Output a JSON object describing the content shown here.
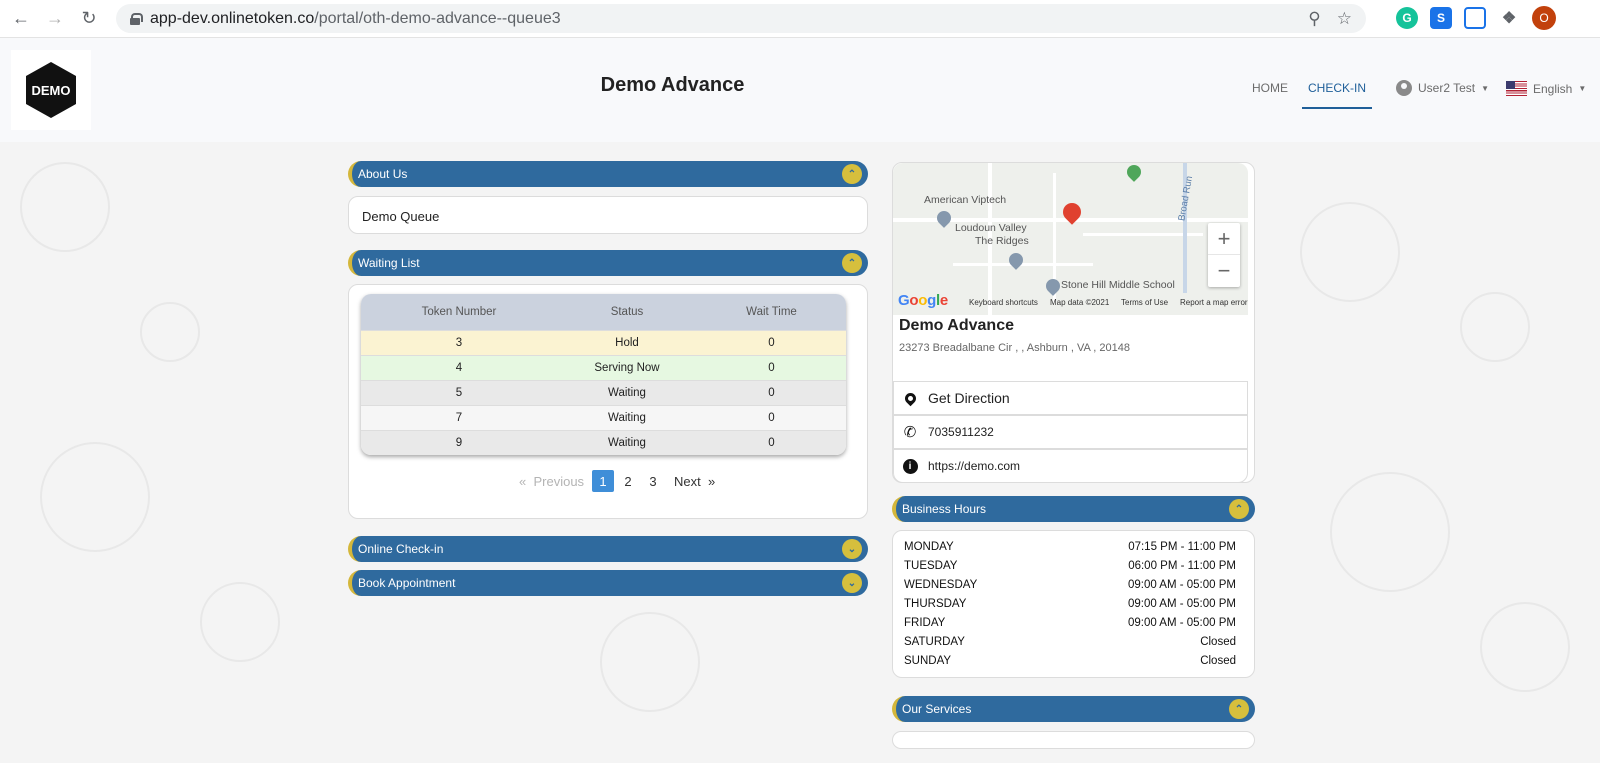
{
  "browser": {
    "url_host": "app-dev.onlinetoken.co",
    "url_path": "/portal/oth-demo-advance--queue3",
    "avatar_initial": "O",
    "ext_s_label": "S"
  },
  "header": {
    "logo_text": "DEMO",
    "title": "Demo Advance",
    "nav": {
      "home": "HOME",
      "checkin": "CHECK-IN"
    },
    "user_label": "User2 Test",
    "language_label": "English"
  },
  "about": {
    "header": "About Us",
    "content": "Demo Queue"
  },
  "waiting_list": {
    "header": "Waiting List",
    "columns": [
      "Token Number",
      "Status",
      "Wait Time"
    ],
    "rows": [
      {
        "token": "3",
        "status": "Hold",
        "wait": "0"
      },
      {
        "token": "4",
        "status": "Serving Now",
        "wait": "0"
      },
      {
        "token": "5",
        "status": "Waiting",
        "wait": "0"
      },
      {
        "token": "7",
        "status": "Waiting",
        "wait": "0"
      },
      {
        "token": "9",
        "status": "Waiting",
        "wait": "0"
      }
    ],
    "pagination": {
      "prev_arrow": "«",
      "previous": "Previous",
      "pages": [
        "1",
        "2",
        "3"
      ],
      "next": "Next",
      "next_arrow": "»"
    }
  },
  "online_checkin": {
    "header": "Online Check-in"
  },
  "book_appointment": {
    "header": "Book Appointment"
  },
  "map": {
    "labels": {
      "american_viptech": "American Viptech",
      "loudoun_valley": "Loudoun Valley",
      "the_ridges": "The Ridges",
      "stone_hill": "Stone Hill Middle School",
      "broad_run": "Broad Run"
    },
    "footer": {
      "shortcuts": "Keyboard shortcuts",
      "map_data": "Map data ©2021",
      "terms": "Terms of Use",
      "report": "Report a map error"
    },
    "google_letters": [
      "G",
      "o",
      "o",
      "g",
      "l",
      "e"
    ]
  },
  "business": {
    "name": "Demo Advance",
    "address": "23273 Breadalbane Cir , , Ashburn , VA , 20148",
    "direction_label": "Get Direction",
    "phone": "7035911232",
    "website": "https://demo.com"
  },
  "hours": {
    "header": "Business Hours",
    "days": [
      {
        "day": "MONDAY",
        "time": "07:15 PM - 11:00 PM"
      },
      {
        "day": "TUESDAY",
        "time": "06:00 PM - 11:00 PM"
      },
      {
        "day": "WEDNESDAY",
        "time": "09:00 AM - 05:00 PM"
      },
      {
        "day": "THURSDAY",
        "time": "09:00 AM - 05:00 PM"
      },
      {
        "day": "FRIDAY",
        "time": "09:00 AM - 05:00 PM"
      },
      {
        "day": "SATURDAY",
        "time": "Closed"
      },
      {
        "day": "SUNDAY",
        "time": "Closed"
      }
    ]
  },
  "services": {
    "header": "Our Services"
  },
  "colors": {
    "accent_blue": "#2f6a9e",
    "toggle_yellow": "#d6bf3d",
    "active_page": "#3f8ed8",
    "hold_row": "#fbf3d2",
    "serving_row": "#e6f8e1"
  },
  "icons": {
    "back": "arrow-left-icon",
    "forward": "arrow-right-icon",
    "reload": "reload-icon",
    "lock": "lock-icon",
    "zoom": "magnifier-icon",
    "star": "star-icon",
    "toggle_up": "chevron-up-icon",
    "toggle_down": "chevron-down-icon",
    "direction": "location-pin-icon",
    "phone": "phone-icon",
    "info": "info-icon"
  }
}
